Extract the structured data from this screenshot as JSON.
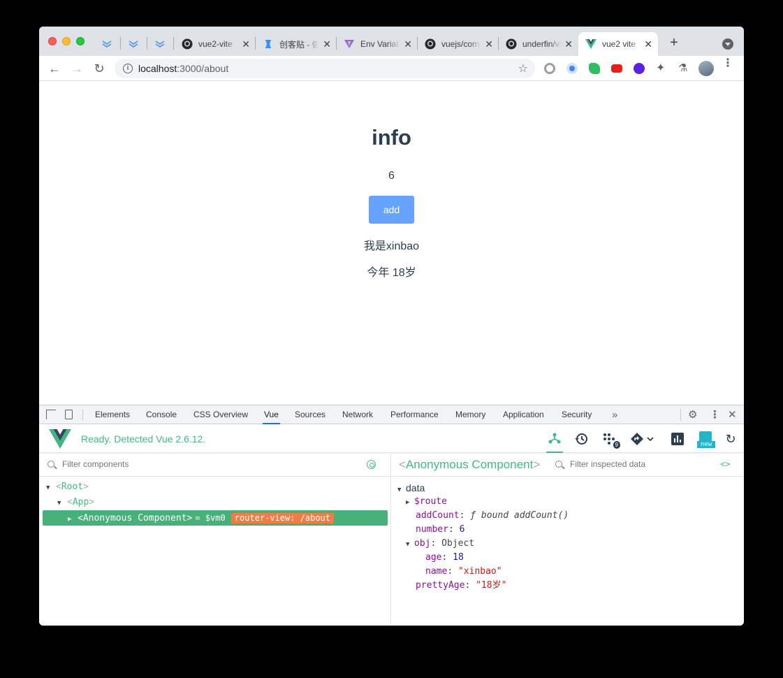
{
  "browser": {
    "tabs": [
      {
        "title": "vue2-vite",
        "icon": "github-icon",
        "close": "✕"
      },
      {
        "title": "创客贴 - 做",
        "icon": "chuangkit-icon",
        "close": "✕"
      },
      {
        "title": "Env Variables",
        "icon": "vite-icon",
        "close": "✕"
      },
      {
        "title": "vuejs/composition",
        "icon": "github-icon",
        "close": "✕"
      },
      {
        "title": "underfin/vite",
        "icon": "github-icon",
        "close": "✕"
      },
      {
        "title": "vue2 vite",
        "icon": "vue-icon",
        "close": "✕",
        "active": true
      }
    ],
    "new_tab": "+",
    "url_host": "localhost",
    "url_rest": ":3000/about"
  },
  "page": {
    "title": "info",
    "count": "6",
    "add_button": "add",
    "name_line": "我是xinbao",
    "age_line": "今年 18岁"
  },
  "devtools": {
    "tabs": [
      "Elements",
      "Console",
      "CSS Overview",
      "Vue",
      "Sources",
      "Network",
      "Performance",
      "Memory",
      "Application",
      "Security"
    ],
    "active_tab": "Vue",
    "more": "»",
    "vue_status": "Ready. Detected Vue 2.6.12.",
    "events_badge": "9",
    "new_label": "new",
    "filter_components_placeholder": "Filter components",
    "filter_data_placeholder": "Filter inspected data",
    "tree": {
      "root": "Root",
      "app": "App",
      "selected": "Anonymous Component",
      "vm_ref": "= $vm0",
      "route_badge": "router-view: /about"
    },
    "inspector": {
      "title": "Anonymous Component",
      "section": "data",
      "route_key": "$route",
      "addcount_key": "addCount",
      "addcount_val": "ƒ bound addCount()",
      "number_key": "number",
      "number_val": "6",
      "obj_key": "obj",
      "obj_val": "Object",
      "age_key": "age",
      "age_val": "18",
      "name_key": "name",
      "name_val": "\"xinbao\"",
      "prettyage_key": "prettyAge",
      "prettyage_val": "\"18岁\""
    }
  },
  "colors": {
    "vue_green": "#42b983",
    "button_blue": "#66a3ff",
    "badge_orange": "#f27c44",
    "text_dark": "#2c3e50"
  }
}
